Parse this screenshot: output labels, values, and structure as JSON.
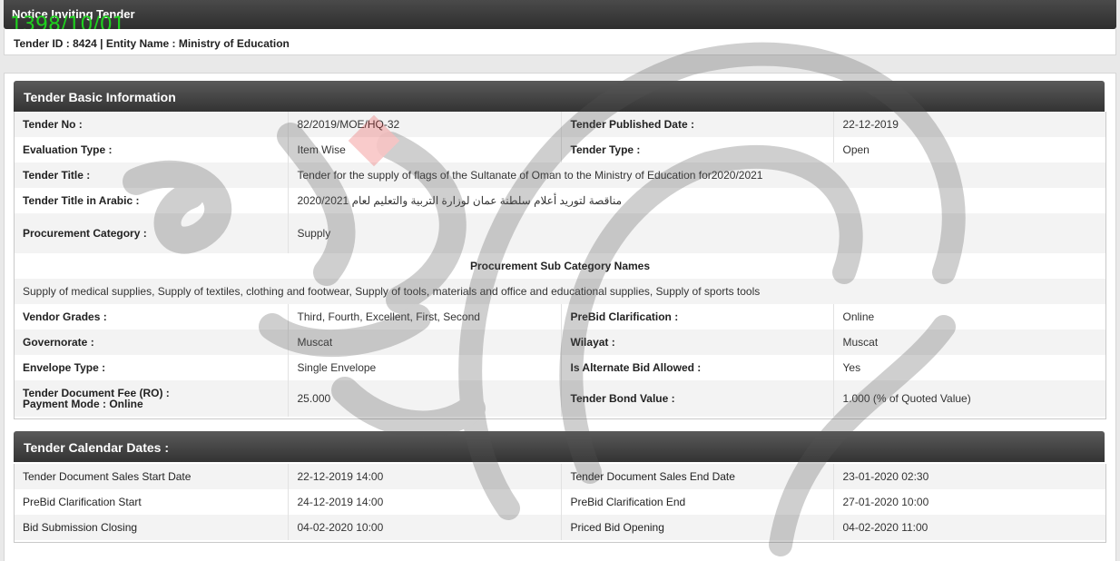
{
  "header": {
    "title": "Notice Inviting Tender",
    "stamp_date": "1398/10/01",
    "tender_id_line": "Tender ID : 8424 | Entity Name : Ministry of Education"
  },
  "basic": {
    "section_title": "Tender Basic Information",
    "tender_no_label": "Tender No :",
    "tender_no": "82/2019/MOE/HQ-32",
    "published_label": "Tender Published Date :",
    "published": "22-12-2019",
    "eval_label": "Evaluation Type :",
    "eval": "Item Wise",
    "type_label": "Tender Type :",
    "type": "Open",
    "title_label": "Tender Title :",
    "title": "Tender for the supply of flags of the Sultanate of Oman to the Ministry of Education for2020/2021",
    "title_ar_label": "Tender Title in Arabic :",
    "title_ar": "مناقصة لتوريد أعلام سلطنة عمان لوزارة التربية والتعليم لعام 2020/2021",
    "proc_cat_label": "Procurement Category :",
    "proc_cat": "Supply",
    "sub_cat_heading": "Procurement Sub Category Names",
    "sub_cats": "Supply of medical supplies, Supply of textiles, clothing and footwear, Supply of tools, materials and office and educational supplies, Supply of sports tools",
    "grades_label": "Vendor Grades :",
    "grades": "Third, Fourth, Excellent, First, Second",
    "prebid_label": "PreBid Clarification :",
    "prebid": "Online",
    "gov_label": "Governorate :",
    "gov": "Muscat",
    "wilayat_label": "Wilayat :",
    "wilayat": "Muscat",
    "envelope_label": "Envelope Type :",
    "envelope": "Single Envelope",
    "alt_bid_label": "Is Alternate Bid Allowed :",
    "alt_bid": "Yes",
    "fee_label": "Tender Document Fee (RO) :",
    "payment_label": "Payment Mode :  Online",
    "fee": "25.000",
    "bond_label": "Tender Bond Value :",
    "bond": "1.000 (% of Quoted Value)"
  },
  "calendar": {
    "section_title": "Tender Calendar Dates :",
    "rows": [
      {
        "l1": "Tender Document Sales Start Date",
        "v1": "22-12-2019 14:00",
        "l2": "Tender Document Sales End Date",
        "v2": "23-01-2020 02:30"
      },
      {
        "l1": "PreBid Clarification Start",
        "v1": "24-12-2019 14:00",
        "l2": "PreBid Clarification End",
        "v2": "27-01-2020 10:00"
      },
      {
        "l1": "Bid Submission Closing",
        "v1": "04-02-2020 10:00",
        "l2": "Priced Bid Opening",
        "v2": "04-02-2020 11:00"
      }
    ]
  },
  "colors": {
    "stamp": "#1fd11f",
    "header_dark": "#333333"
  }
}
